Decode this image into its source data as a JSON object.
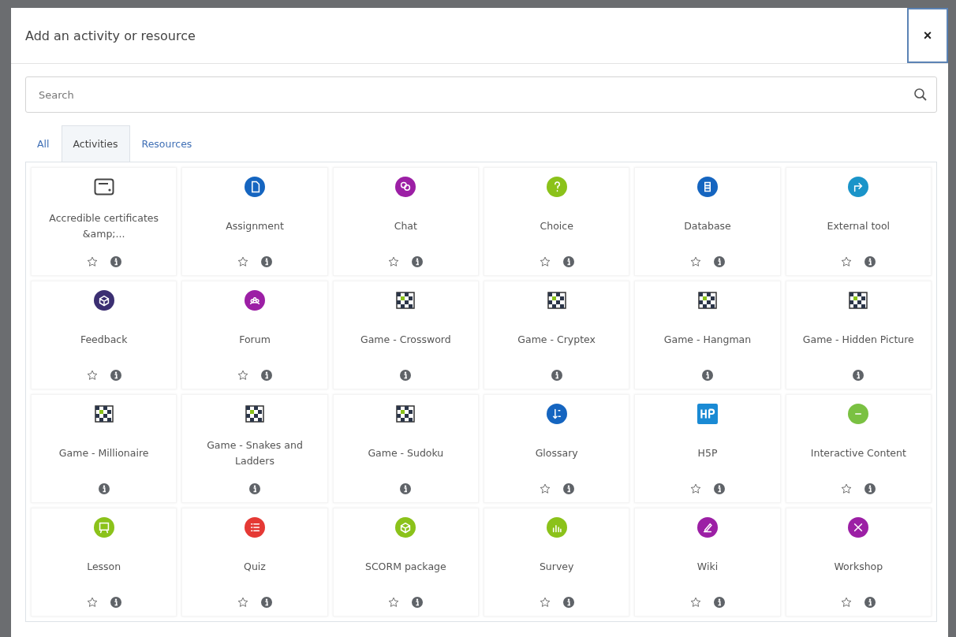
{
  "dialog": {
    "title": "Add an activity or resource",
    "close": "×"
  },
  "search": {
    "placeholder": "Search"
  },
  "tabs": [
    {
      "label": "All",
      "selected": false
    },
    {
      "label": "Activities",
      "selected": true
    },
    {
      "label": "Resources",
      "selected": false
    }
  ],
  "items": [
    {
      "name": "Accredible certificates &amp;...",
      "kind": "outline",
      "starred": false
    },
    {
      "name": "Assignment",
      "kind": "circle",
      "color": "#1565c0",
      "starred": false
    },
    {
      "name": "Chat",
      "kind": "circle",
      "color": "#9c1fa5",
      "starred": false
    },
    {
      "name": "Choice",
      "kind": "circle",
      "color": "#8bc21a",
      "starred": false
    },
    {
      "name": "Database",
      "kind": "circle",
      "color": "#1565c0",
      "starred": false
    },
    {
      "name": "External tool",
      "kind": "circle",
      "color": "#1a94c9",
      "starred": false
    },
    {
      "name": "Feedback",
      "kind": "circle",
      "color": "#3b2f72",
      "starred": false
    },
    {
      "name": "Forum",
      "kind": "circle",
      "color": "#9c1fa5",
      "starred": false
    },
    {
      "name": "Game - Crossword",
      "kind": "chessboard"
    },
    {
      "name": "Game - Cryptex",
      "kind": "chessboard"
    },
    {
      "name": "Game - Hangman",
      "kind": "chessboard"
    },
    {
      "name": "Game - Hidden Picture",
      "kind": "chessboard"
    },
    {
      "name": "Game - Millionaire",
      "kind": "chessboard"
    },
    {
      "name": "Game - Snakes and Ladders",
      "kind": "chessboard"
    },
    {
      "name": "Game - Sudoku",
      "kind": "chessboard"
    },
    {
      "name": "Glossary",
      "kind": "circle",
      "color": "#1565c0",
      "starred": false
    },
    {
      "name": "H5P",
      "kind": "square",
      "color": "#1a8ad4",
      "starred": false
    },
    {
      "name": "Interactive Content",
      "kind": "circle",
      "color": "#7ac142",
      "starred": false
    },
    {
      "name": "Lesson",
      "kind": "circle",
      "color": "#8bc21a",
      "starred": false
    },
    {
      "name": "Quiz",
      "kind": "circle",
      "color": "#e53935",
      "starred": false
    },
    {
      "name": "SCORM package",
      "kind": "circle",
      "color": "#8bc21a",
      "starred": false
    },
    {
      "name": "Survey",
      "kind": "circle",
      "color": "#8bc21a",
      "starred": false
    },
    {
      "name": "Wiki",
      "kind": "circle",
      "color": "#9c1fa5",
      "starred": false
    },
    {
      "name": "Workshop",
      "kind": "circle",
      "color": "#9c1fa5",
      "starred": false
    }
  ]
}
